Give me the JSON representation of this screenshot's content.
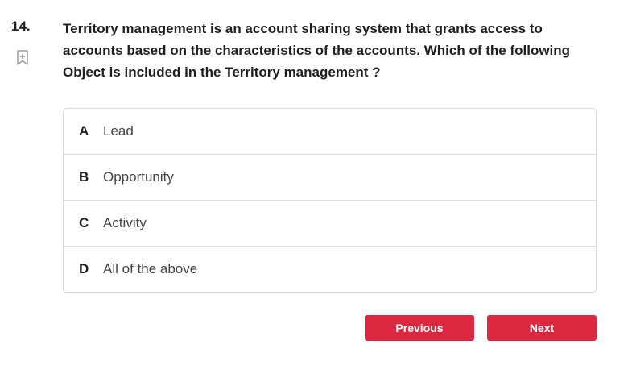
{
  "question": {
    "number": "14.",
    "text": "Territory management is an account sharing system that grants access to accounts based on the characteristics of the accounts. Which of the following Object is included in the Territory management ?",
    "bookmark_icon": "bookmark-add-icon"
  },
  "options": [
    {
      "letter": "A",
      "text": "Lead"
    },
    {
      "letter": "B",
      "text": "Opportunity"
    },
    {
      "letter": "C",
      "text": "Activity"
    },
    {
      "letter": "D",
      "text": "All of the above"
    }
  ],
  "navigation": {
    "previous_label": "Previous",
    "next_label": "Next"
  },
  "colors": {
    "button": "#db2840",
    "border": "#d9d9d9"
  }
}
